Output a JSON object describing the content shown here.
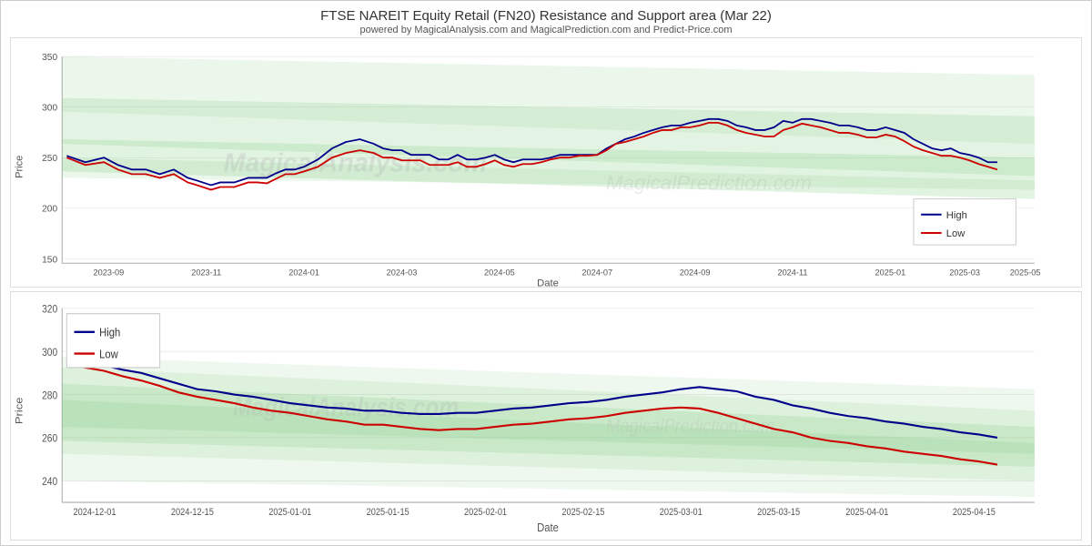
{
  "header": {
    "title": "FTSE NAREIT Equity Retail (FN20) Resistance and Support area (Mar 22)",
    "subtitle": "powered by MagicalAnalysis.com and MagicalPrediction.com and Predict-Price.com"
  },
  "chart1": {
    "y_label": "Price",
    "x_label": "Date",
    "y_ticks": [
      "350",
      "300",
      "250",
      "200"
    ],
    "x_ticks": [
      "2023-09",
      "2023-11",
      "2024-01",
      "2024-03",
      "2024-05",
      "2024-07",
      "2024-09",
      "2024-11",
      "2025-01",
      "2025-03",
      "2025-05"
    ],
    "legend": {
      "high_label": "High",
      "low_label": "Low"
    },
    "watermark": "MagicalAnalysis.com",
    "watermark2": "MagicalPrediction.com"
  },
  "chart2": {
    "y_label": "Price",
    "x_label": "Date",
    "y_ticks": [
      "320",
      "300",
      "280",
      "260",
      "240"
    ],
    "x_ticks": [
      "2024-12-01",
      "2024-12-15",
      "2025-01-01",
      "2025-01-15",
      "2025-02-01",
      "2025-02-15",
      "2025-03-01",
      "2025-03-15",
      "2025-04-01",
      "2025-04-15"
    ],
    "legend": {
      "high_label": "High",
      "low_label": "Low"
    },
    "watermark": "MagicalAnalysis.com",
    "watermark2": "MagicalPrediction.com"
  },
  "colors": {
    "high_line": "#00008B",
    "low_line": "#CC0000",
    "band_fill": "rgba(100,180,100,0.25)",
    "band_fill2": "rgba(100,180,100,0.18)",
    "band_fill3": "rgba(100,180,100,0.12)"
  }
}
